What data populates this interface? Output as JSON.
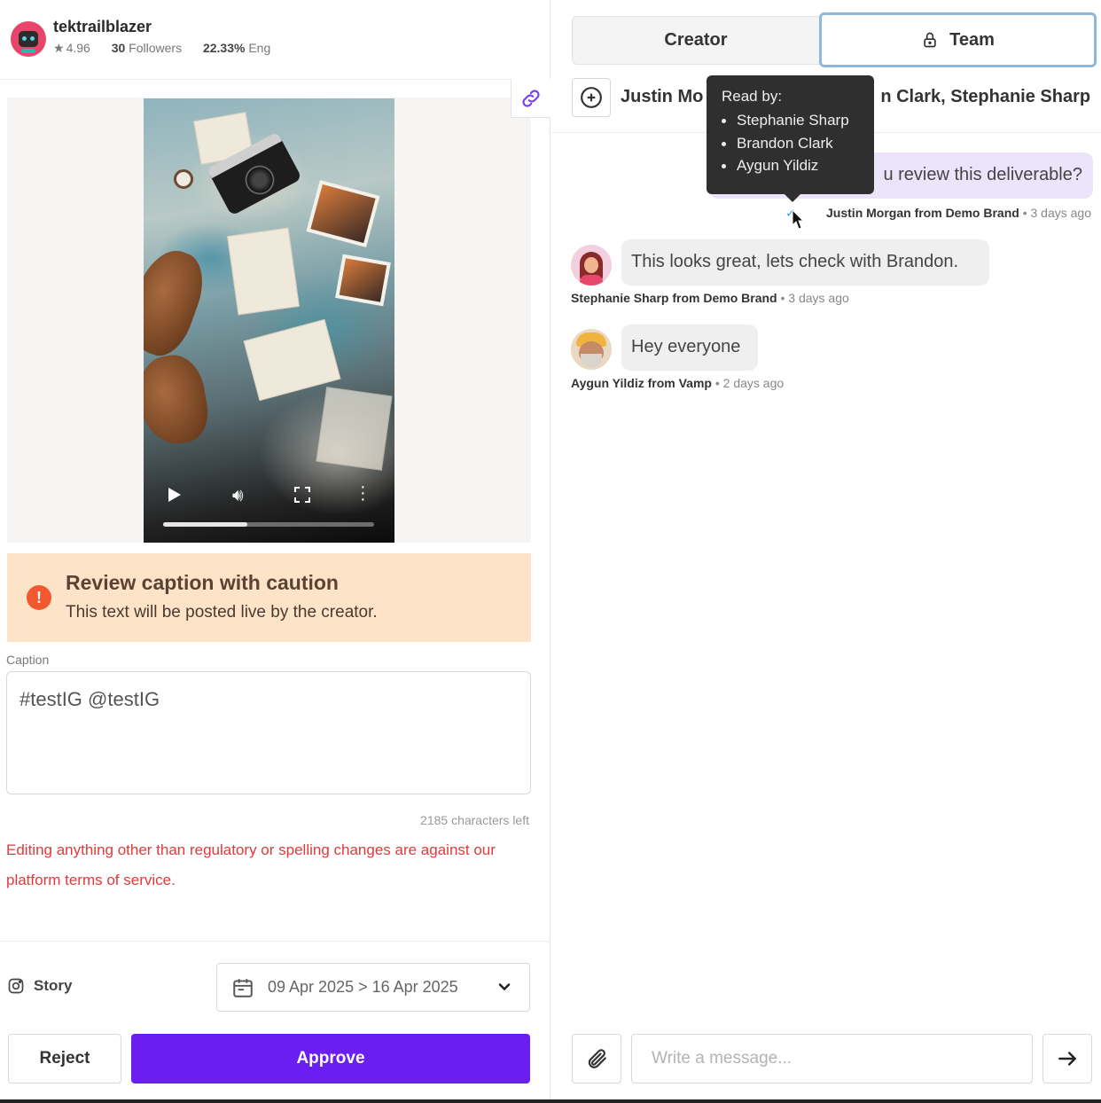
{
  "profile": {
    "username": "tektrailblazer",
    "rating": "4.96",
    "followers_count": "30",
    "followers_label": "Followers",
    "engagement_value": "22.33%",
    "engagement_label": "Eng"
  },
  "video": {
    "progress_fraction": 0.4
  },
  "warning": {
    "title": "Review caption with caution",
    "text": "This text will be posted live by the creator."
  },
  "caption": {
    "label": "Caption",
    "value": "#testIG @testIG",
    "chars_left": "2185 characters left",
    "tos_warning": "Editing anything other than regulatory or spelling changes are against our platform terms of service."
  },
  "post": {
    "type_label": "Story",
    "date_range": "09 Apr 2025 > 16 Apr 2025"
  },
  "actions": {
    "reject_label": "Reject",
    "approve_label": "Approve"
  },
  "tabs": {
    "creator_label": "Creator",
    "team_label": "Team"
  },
  "participants": {
    "visible_start": "Justin Mo",
    "visible_end": "n Clark, Stephanie Sharp"
  },
  "tooltip": {
    "title": "Read by:",
    "readers": [
      "Stephanie Sharp",
      "Brandon Clark",
      "Aygun Yildiz"
    ]
  },
  "messages": [
    {
      "text": "u review this deliverable?",
      "author": "Justin Morgan from Demo Brand",
      "time": "3 days ago"
    },
    {
      "text": "This looks great, lets check with Brandon.",
      "author": "Stephanie Sharp from Demo Brand",
      "time": "3 days ago"
    },
    {
      "text": "Hey everyone",
      "author": "Aygun Yildiz from Vamp",
      "time": "2 days ago"
    }
  ],
  "composer": {
    "placeholder": "Write a message..."
  },
  "colors": {
    "approve": "#6a1ff0",
    "warning_bg": "#fde4c8",
    "warning_icon": "#f0592f",
    "error_text": "#e23a3a",
    "own_bubble": "#ebe4fb",
    "team_tab_border": "#8fb8d8"
  }
}
